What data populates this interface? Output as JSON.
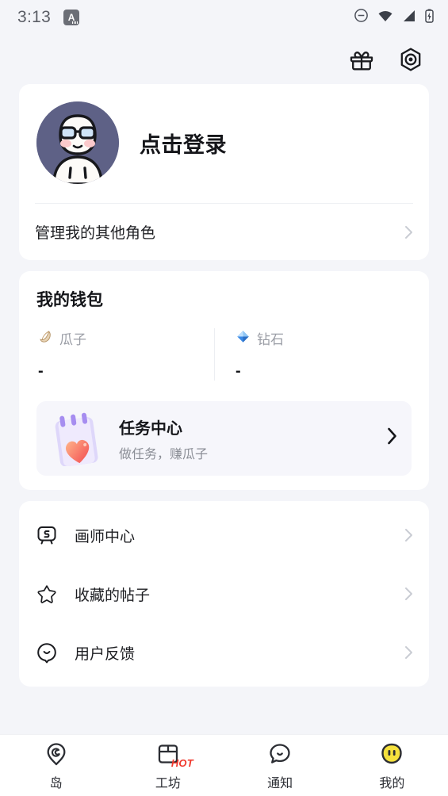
{
  "statusbar": {
    "time": "3:13",
    "app_badge_letter": "A",
    "icons": [
      "dnd-icon",
      "wifi-icon",
      "signal-icon",
      "battery-charging-icon"
    ]
  },
  "topbar": {
    "gift_label": "gift-icon",
    "settings_label": "settings-hexagon-icon"
  },
  "profile": {
    "nickname": "点击登录",
    "avatar_bg": "#5e6186",
    "manage_roles_label": "管理我的其他角色"
  },
  "wallet": {
    "title": "我的钱包",
    "currencies": [
      {
        "icon": "seed-icon",
        "name": "瓜子",
        "value": "-"
      },
      {
        "icon": "diamond-icon",
        "name": "钻石",
        "value": "-"
      }
    ],
    "task_banner": {
      "icon": "notepad-heart-icon",
      "title": "任务中心",
      "subtitle": "做任务，赚瓜子"
    }
  },
  "menu": {
    "items": [
      {
        "icon": "drawing-board-icon",
        "label": "画师中心"
      },
      {
        "icon": "star-icon",
        "label": "收藏的帖子"
      },
      {
        "icon": "feedback-smile-icon",
        "label": "用户反馈"
      }
    ]
  },
  "tabbar": {
    "items": [
      {
        "icon": "island-pin-icon",
        "label": "岛",
        "active": false,
        "badge": ""
      },
      {
        "icon": "workshop-box-icon",
        "label": "工坊",
        "active": false,
        "badge": "HOT"
      },
      {
        "icon": "notification-bubble-icon",
        "label": "通知",
        "active": false,
        "badge": ""
      },
      {
        "icon": "profile-face-icon",
        "label": "我的",
        "active": true,
        "badge": ""
      }
    ]
  },
  "colors": {
    "page_bg": "#f4f5f9",
    "card_bg": "#ffffff",
    "accent_hot": "#f0372b",
    "accent_active": "#f5e13d",
    "text_primary": "#15161a",
    "text_muted": "#8b8e96"
  }
}
